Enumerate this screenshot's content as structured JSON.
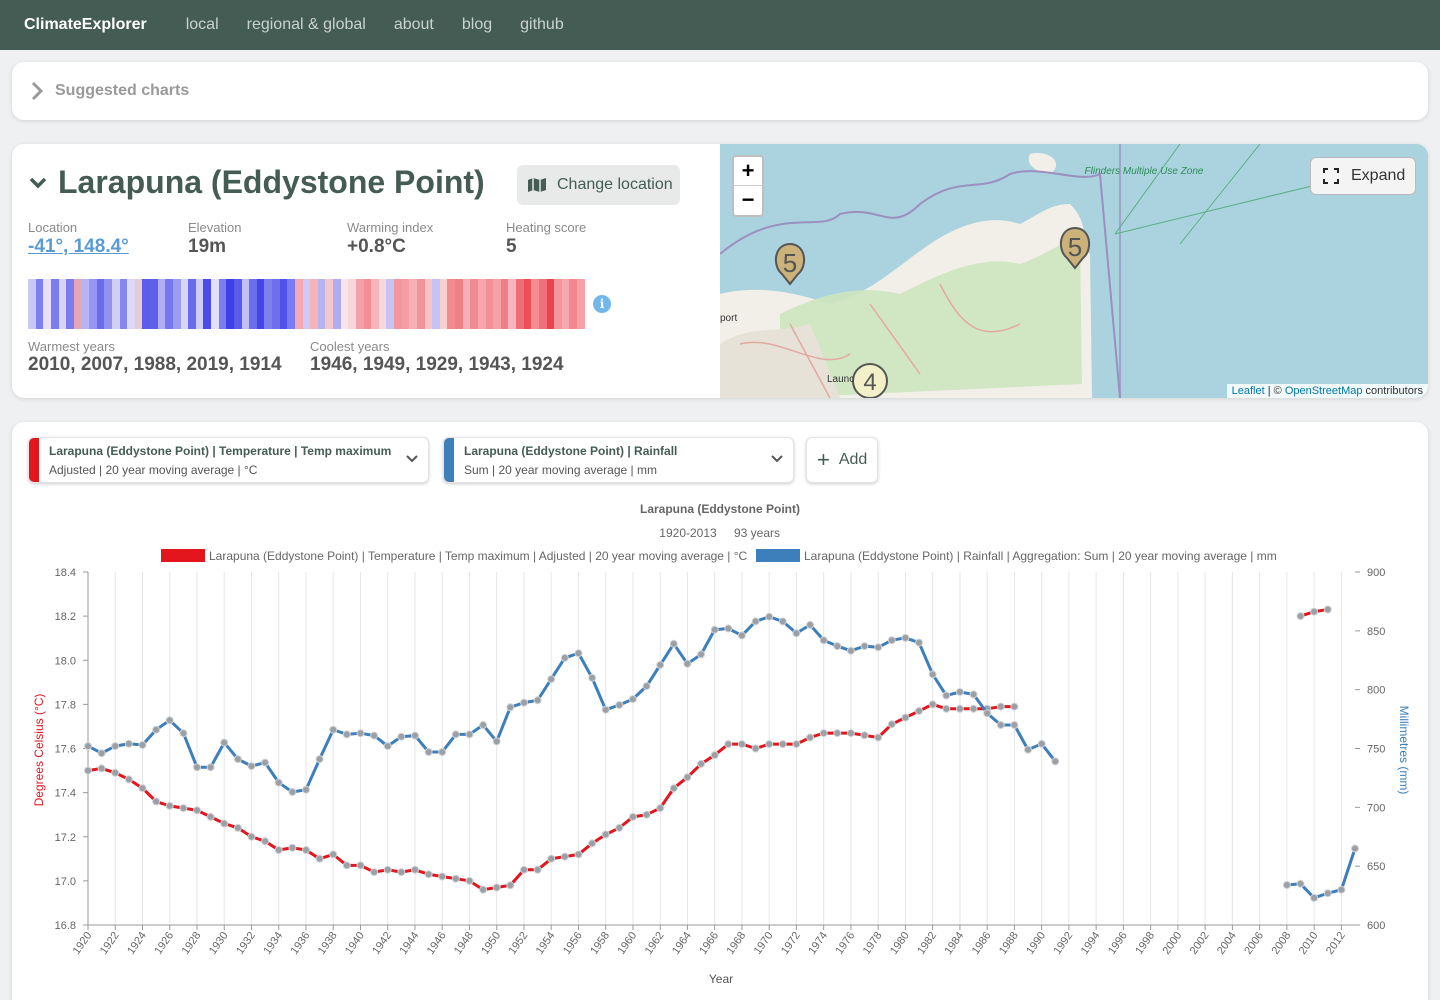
{
  "nav": {
    "brand": "ClimateExplorer",
    "links": [
      "local",
      "regional & global",
      "about",
      "blog",
      "github"
    ]
  },
  "suggested": {
    "label": "Suggested charts"
  },
  "location": {
    "title": "Larapuna (Eddystone Point)",
    "change_label": "Change location",
    "stats": [
      {
        "key": "Location",
        "value": "-41°, 148.4°"
      },
      {
        "key": "Elevation",
        "value": "19m"
      },
      {
        "key": "Warming index",
        "value": "+0.8°C"
      },
      {
        "key": "Heating score",
        "value": "5"
      }
    ],
    "warmest_label": "Warmest years",
    "warmest_value": "2010, 2007, 1988, 2019, 1914",
    "coolest_label": "Coolest years",
    "coolest_value": "1946, 1949, 1929, 1943, 1924",
    "stripe_colors": [
      "#c9c8f5",
      "#7d7ef0",
      "#e8e0f7",
      "#7a7cef",
      "#d9d4f7",
      "#7c7cf0",
      "#e7a6b6",
      "#b5b4f4",
      "#9796f2",
      "#6a6bee",
      "#9192f2",
      "#d1cff6",
      "#8586f0",
      "#dcd9f7",
      "#e8c9d6",
      "#5b5ceb",
      "#5e5feb",
      "#b0aff3",
      "#7778ef",
      "#9d9df2",
      "#d8d5f7",
      "#6a6aee",
      "#cfcdf6",
      "#4a4be9",
      "#e3dff7",
      "#7b7cf0",
      "#3e3fe7",
      "#5a5aeb",
      "#c1c0f5",
      "#6d6eee",
      "#4545e9",
      "#7f80f0",
      "#6f6fee",
      "#5152ea",
      "#7a7bef",
      "#f2a9b1",
      "#cdcaf6",
      "#f6b3b8",
      "#b6b5f4",
      "#f5c6c9",
      "#aeacf3",
      "#f8e6e8",
      "#f6d8db",
      "#f3a1a7",
      "#f28f95",
      "#f5b5ba",
      "#f7d7da",
      "#c5c4f5",
      "#f2979d",
      "#f49ea4",
      "#f4b0b5",
      "#f29399",
      "#f6c3c6",
      "#c4c3f5",
      "#f6cfd2",
      "#f28a91",
      "#f08088",
      "#f6b0b5",
      "#f08b92",
      "#f7a6ab",
      "#f29096",
      "#f3a2a7",
      "#ef7f86",
      "#f6b6bb",
      "#ef6e76",
      "#ec4f58",
      "#f28d94",
      "#ee7179",
      "#e9434d",
      "#f3979d",
      "#f6a9ae",
      "#f2878e",
      "#f4a2a7"
    ],
    "map": {
      "zoom_in": "+",
      "zoom_out": "−",
      "expand_label": "Expand",
      "marker_5a": "5",
      "marker_5b": "5",
      "marker_4": "4",
      "label_flinders": "Flinders Multiple Use Zone",
      "label_port": "port",
      "label_launc": "Launc",
      "attribution_leaflet": "Leaflet",
      "attribution_sep": " | © ",
      "attribution_osm": "OpenStreetMap",
      "attribution_rest": " contributors",
      "colors": {
        "water": "#aad3df",
        "land": "#f2efe9",
        "forest": "#cde5bf",
        "boundary": "#9b8fbf"
      }
    }
  },
  "selectors": [
    {
      "line1": "Larapuna (Eddystone Point) | Temperature | Temp maximum",
      "line2": "Adjusted | 20 year moving average | °C",
      "color": "#e3161e"
    },
    {
      "line1": "Larapuna (Eddystone Point) | Rainfall",
      "line2": "Sum | 20 year moving average | mm",
      "color": "#3d7fbb"
    }
  ],
  "add_label": "Add",
  "chart_data": {
    "type": "line",
    "title": "Larapuna (Eddystone Point)",
    "subtitle_range": "1920-2013",
    "subtitle_years": "93 years",
    "xlabel": "Year",
    "ylabel_left": "Degrees Celsius (°C)",
    "ylabel_right": "Millimetres (mm)",
    "legend_position": "top",
    "grid": true,
    "x_ticks": [
      1920,
      1922,
      1924,
      1926,
      1928,
      1930,
      1932,
      1934,
      1936,
      1938,
      1940,
      1942,
      1944,
      1946,
      1948,
      1950,
      1952,
      1954,
      1956,
      1958,
      1960,
      1962,
      1964,
      1966,
      1968,
      1970,
      1972,
      1974,
      1976,
      1978,
      1980,
      1982,
      1984,
      1986,
      1988,
      1990,
      1992,
      1994,
      1996,
      1998,
      2000,
      2002,
      2004,
      2006,
      2008,
      2010,
      2012
    ],
    "xlim": [
      1920,
      2013
    ],
    "ylim_left": [
      16.8,
      18.4
    ],
    "yticks_left": [
      "16.8",
      "17.0",
      "17.2",
      "17.4",
      "17.6",
      "17.8",
      "18.0",
      "18.2",
      "18.4"
    ],
    "ylim_right": [
      600,
      900
    ],
    "yticks_right": [
      "600",
      "650",
      "700",
      "750",
      "800",
      "850",
      "900"
    ],
    "series": [
      {
        "name": "Larapuna (Eddystone Point) | Temperature | Temp maximum | Adjusted | 20 year moving average | °C",
        "axis": "left",
        "color": "#e3161e",
        "segments": [
          {
            "x": [
              1920,
              1921,
              1922,
              1923,
              1924,
              1925,
              1926,
              1927,
              1928,
              1929,
              1930,
              1931,
              1932,
              1933,
              1934,
              1935,
              1936,
              1937,
              1938,
              1939,
              1940,
              1941,
              1942,
              1943,
              1944,
              1945,
              1946,
              1947,
              1948,
              1949,
              1950,
              1951,
              1952,
              1953,
              1954,
              1955,
              1956,
              1957,
              1958,
              1959,
              1960,
              1961,
              1962,
              1963,
              1964,
              1965,
              1966,
              1967,
              1968,
              1969,
              1970,
              1971,
              1972,
              1973,
              1974,
              1975,
              1976,
              1977,
              1978,
              1979,
              1980,
              1981,
              1982,
              1983,
              1984,
              1985,
              1986,
              1987,
              1988
            ],
            "y": [
              17.5,
              17.51,
              17.49,
              17.46,
              17.42,
              17.36,
              17.34,
              17.33,
              17.32,
              17.29,
              17.26,
              17.24,
              17.2,
              17.18,
              17.14,
              17.15,
              17.14,
              17.1,
              17.12,
              17.07,
              17.07,
              17.04,
              17.05,
              17.04,
              17.05,
              17.03,
              17.02,
              17.01,
              17.0,
              16.96,
              16.97,
              16.98,
              17.05,
              17.05,
              17.1,
              17.11,
              17.12,
              17.17,
              17.21,
              17.24,
              17.29,
              17.3,
              17.33,
              17.42,
              17.47,
              17.53,
              17.57,
              17.62,
              17.62,
              17.6,
              17.62,
              17.62,
              17.62,
              17.65,
              17.67,
              17.67,
              17.67,
              17.66,
              17.65,
              17.71,
              17.74,
              17.77,
              17.8,
              17.78,
              17.78,
              17.78,
              17.78,
              17.79,
              17.79
            ]
          },
          {
            "x": [
              2009,
              2010,
              2011
            ],
            "y": [
              18.2,
              18.22,
              18.23
            ]
          }
        ]
      },
      {
        "name": "Larapuna (Eddystone Point) | Rainfall | Aggregation: Sum | 20 year moving average | mm",
        "axis": "right",
        "color": "#3d7fbb",
        "segments": [
          {
            "x": [
              1920,
              1921,
              1922,
              1923,
              1924,
              1925,
              1926,
              1927,
              1928,
              1929,
              1930,
              1931,
              1932,
              1933,
              1934,
              1935,
              1936,
              1937,
              1938,
              1939,
              1940,
              1941,
              1942,
              1943,
              1944,
              1945,
              1946,
              1947,
              1948,
              1949,
              1950,
              1951,
              1952,
              1953,
              1954,
              1955,
              1956,
              1957,
              1958,
              1959,
              1960,
              1961,
              1962,
              1963,
              1964,
              1965,
              1966,
              1967,
              1968,
              1969,
              1970,
              1971,
              1972,
              1973,
              1974,
              1975,
              1976,
              1977,
              1978,
              1979,
              1980,
              1981,
              1982,
              1983,
              1984,
              1985,
              1986,
              1987,
              1988,
              1989,
              1990,
              1991
            ],
            "y": [
              752,
              746,
              752,
              754,
              753,
              766,
              774,
              763,
              734,
              734,
              755,
              741,
              735,
              738,
              721,
              713,
              715,
              741,
              766,
              762,
              763,
              761,
              752,
              760,
              761,
              747,
              747,
              762,
              762,
              770,
              756,
              785,
              789,
              791,
              809,
              827,
              831,
              810,
              783,
              787,
              792,
              803,
              821,
              839,
              822,
              830,
              851,
              852,
              846,
              858,
              862,
              858,
              848,
              855,
              842,
              837,
              833,
              837,
              836,
              842,
              844,
              840,
              813,
              795,
              798,
              796,
              780,
              770,
              770,
              749,
              754,
              739
            ]
          },
          {
            "x": [
              2008,
              2009,
              2010,
              2011,
              2012,
              2013
            ],
            "y": [
              634,
              635,
              623,
              627,
              630,
              665
            ]
          }
        ]
      }
    ]
  }
}
